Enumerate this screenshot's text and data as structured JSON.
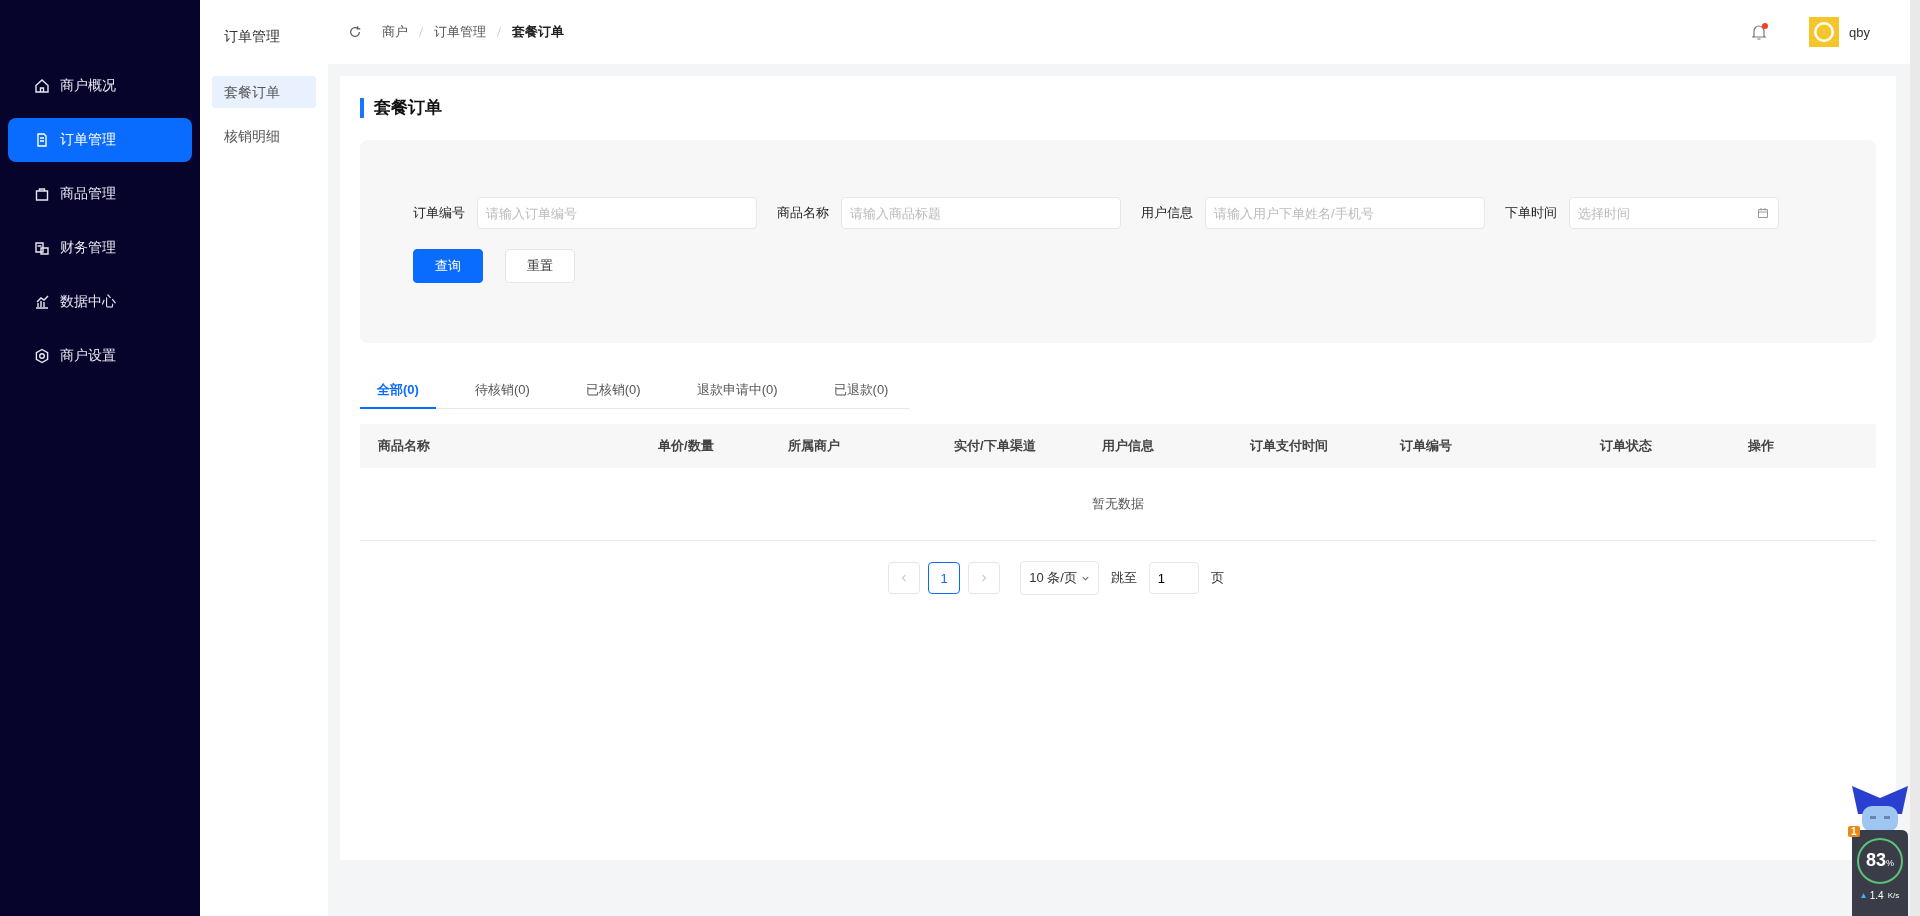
{
  "sidebar": {
    "items": [
      {
        "label": "商户概况",
        "selected": false
      },
      {
        "label": "订单管理",
        "selected": true
      },
      {
        "label": "商品管理",
        "selected": false
      },
      {
        "label": "财务管理",
        "selected": false
      },
      {
        "label": "数据中心",
        "selected": false
      },
      {
        "label": "商户设置",
        "selected": false
      }
    ]
  },
  "submenu": {
    "title": "订单管理",
    "items": [
      {
        "label": "套餐订单",
        "selected": true
      },
      {
        "label": "核销明细",
        "selected": false
      }
    ]
  },
  "header": {
    "breadcrumb": [
      "商户",
      "订单管理",
      "套餐订单"
    ],
    "notification": true,
    "user": "qby"
  },
  "page": {
    "title": "套餐订单"
  },
  "filters": [
    {
      "label": "订单编号",
      "placeholder": "请输入订单编号",
      "kind": "text"
    },
    {
      "label": "商品名称",
      "placeholder": "请输入商品标题",
      "kind": "text"
    },
    {
      "label": "用户信息",
      "placeholder": "请输入用户下单姓名/手机号",
      "kind": "text"
    },
    {
      "label": "下单时间",
      "placeholder": "选择时间",
      "kind": "date"
    }
  ],
  "buttons": [
    "查询",
    "重置"
  ],
  "tabs": [
    {
      "label": "全部(0)",
      "selected": true
    },
    {
      "label": "待核销(0)",
      "selected": false
    },
    {
      "label": "已核销(0)",
      "selected": false
    },
    {
      "label": "退款申请中(0)",
      "selected": false
    },
    {
      "label": "已退款(0)",
      "selected": false
    }
  ],
  "table": {
    "columns": [
      "商品名称",
      "单价/数量",
      "所属商户",
      "实付/下单渠道",
      "用户信息",
      "订单支付时间",
      "订单编号",
      "订单状态",
      "操作"
    ],
    "empty_text": "暂无数据"
  },
  "pagination": {
    "page": "1",
    "page_size": "10 条/页",
    "jump_label": "跳至",
    "jump_value": "1",
    "page_suffix": "页"
  },
  "monitor": {
    "badge": "1",
    "percent": "83",
    "percent_unit": "%",
    "speed": "1.4",
    "speed_unit": "K/s"
  }
}
